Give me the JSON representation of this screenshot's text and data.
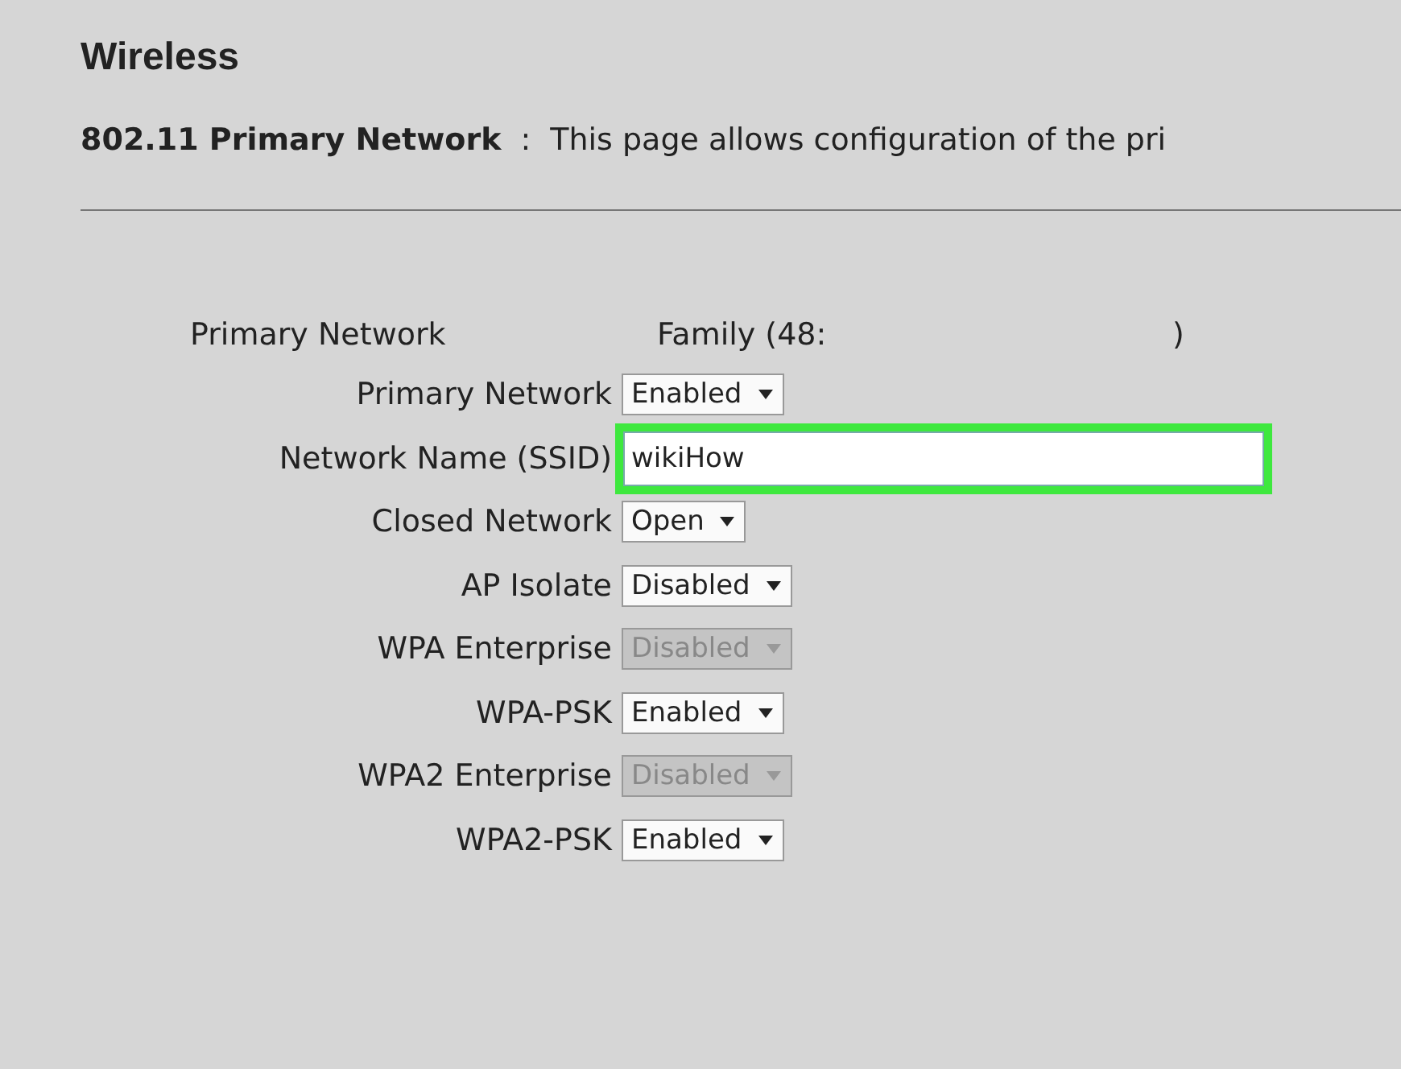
{
  "page": {
    "title": "Wireless",
    "section": "802.11 Primary Network",
    "separator": ":",
    "description": "This page allows configuration of the pri"
  },
  "network": {
    "label": "Primary Network",
    "value": "Family (48:",
    "close": ")"
  },
  "fields": [
    {
      "kind": "select",
      "label": "Primary Network",
      "value": "Enabled",
      "disabled": false
    },
    {
      "kind": "text",
      "label": "Network Name (SSID)",
      "value": "wikiHow",
      "highlighted": true
    },
    {
      "kind": "select",
      "label": "Closed Network",
      "value": "Open",
      "disabled": false
    },
    {
      "kind": "select",
      "label": "AP Isolate",
      "value": "Disabled",
      "disabled": false
    },
    {
      "kind": "select",
      "label": "WPA Enterprise",
      "value": "Disabled",
      "disabled": true
    },
    {
      "kind": "select",
      "label": "WPA-PSK",
      "value": "Enabled",
      "disabled": false
    },
    {
      "kind": "select",
      "label": "WPA2 Enterprise",
      "value": "Disabled",
      "disabled": true
    },
    {
      "kind": "select",
      "label": "WPA2-PSK",
      "value": "Enabled",
      "disabled": false
    }
  ]
}
